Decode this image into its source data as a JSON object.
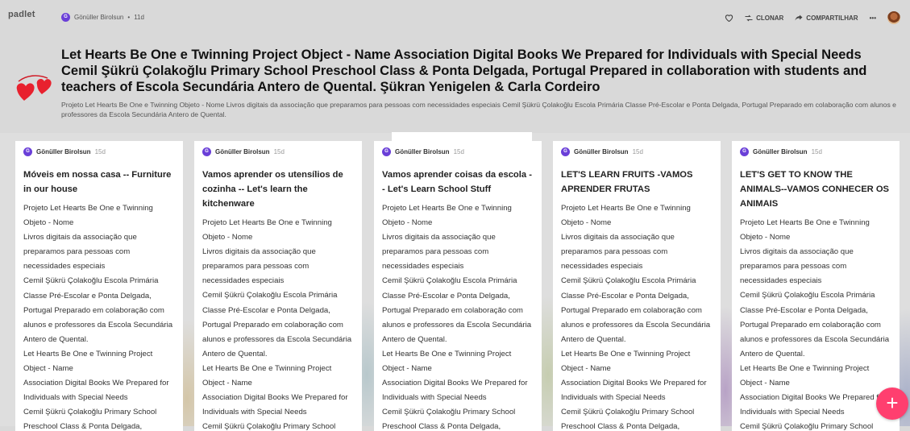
{
  "app": {
    "logo": "padlet"
  },
  "toolbar": {
    "clone_label": "CLONAR",
    "share_label": "COMPARTILHAR",
    "more_label": "•••"
  },
  "board": {
    "author": "Gönüller Birolsun",
    "author_initial": "G",
    "separator": "•",
    "age": "11d",
    "title": "Let Hearts Be One e Twinning Project Object - Name Association Digital Books We Prepared for Individuals with Special Needs Cemil Şükrü Çolakoğlu Primary School Preschool Class & Ponta Delgada, Portugal Prepared in collaboration with students and teachers of Escola Secundária Antero de Quental. Şükran Yenigelen & Carla Cordeiro",
    "description": "Projeto Let Hearts Be One e Twinning Objeto - Nome Livros digitais da associação que preparamos para pessoas com necessidades especiais Cemil Şükrü Çolakoğlu Escola Primária Classe Pré-Escolar e Ponta Delgada, Portugal Preparado em colaboração com alunos e professores da Escola Secundária Antero de Quental."
  },
  "cards": [
    {
      "author": "Gönüller Birolsun",
      "author_initial": "G",
      "age": "15d",
      "title": "Móveis em nossa casa -- Furniture in our house",
      "body": "Projeto Let Hearts Be One e Twinning Objeto - Nome\n Livros digitais da associação que preparamos para pessoas com necessidades especiais\nCemil Şükrü Çolakoğlu Escola Primária Classe Pré-Escolar e Ponta Delgada, Portugal Preparado em colaboração com alunos e professores da Escola Secundária Antero de Quental.\nLet Hearts Be One e Twinning Project Object - Name\n Association Digital Books We Prepared for Individuals with Special Needs\nCemil Şükrü Çolakoğlu Primary School Preschool Class & Ponta Delgada,"
    },
    {
      "author": "Gönüller Birolsun",
      "author_initial": "G",
      "age": "15d",
      "title": "Vamos aprender os utensílios de cozinha -- Let's learn the kitchenware",
      "body": "Projeto Let Hearts Be One e Twinning Objeto - Nome\n Livros digitais da associação que preparamos para pessoas com necessidades especiais\nCemil Şükrü Çolakoğlu Escola Primária Classe Pré-Escolar e Ponta Delgada, Portugal Preparado em colaboração com alunos e professores da Escola Secundária Antero de Quental.\nLet Hearts Be One e Twinning Project Object - Name\n Association Digital Books We Prepared for Individuals with Special Needs\nCemil Şükrü Çolakoğlu Primary School"
    },
    {
      "author": "Gönüller Birolsun",
      "author_initial": "G",
      "age": "15d",
      "title": "Vamos aprender coisas da escola -- Let's Learn School Stuff",
      "body": "Projeto Let Hearts Be One e Twinning Objeto - Nome\n Livros digitais da associação que preparamos para pessoas com necessidades especiais\nCemil Şükrü Çolakoğlu Escola Primária Classe Pré-Escolar e Ponta Delgada, Portugal Preparado em colaboração com alunos e professores da Escola Secundária Antero de Quental.\nLet Hearts Be One e Twinning Project Object - Name\n Association Digital Books We Prepared for Individuals with Special Needs\nCemil Şükrü Çolakoğlu Primary School Preschool Class & Ponta Delgada,"
    },
    {
      "author": "Gönüller Birolsun",
      "author_initial": "G",
      "age": "15d",
      "title": "LET'S LEARN FRUITS -VAMOS APRENDER FRUTAS",
      "body": "Projeto Let Hearts Be One e Twinning Objeto - Nome\n Livros digitais da associação que preparamos para pessoas com necessidades especiais\nCemil Şükrü Çolakoğlu Escola Primária Classe Pré-Escolar e Ponta Delgada, Portugal Preparado em colaboração com alunos e professores da Escola Secundária Antero de Quental.\nLet Hearts Be One e Twinning Project Object - Name\n Association Digital Books We Prepared for Individuals with Special Needs\nCemil Şükrü Çolakoğlu Primary School Preschool Class & Ponta Delgada,"
    },
    {
      "author": "Gönüller Birolsun",
      "author_initial": "G",
      "age": "15d",
      "title": "LET'S GET TO KNOW THE ANIMALS--VAMOS CONHECER OS ANIMAIS",
      "body": "Projeto Let Hearts Be One e Twinning Objeto - Nome\n Livros digitais da associação que preparamos para pessoas com necessidades especiais\nCemil Şükrü Çolakoğlu Escola Primária Classe Pré-Escolar e Ponta Delgada, Portugal Preparado em colaboração com alunos e professores da Escola Secundária Antero de Quental.\nLet Hearts Be One e Twinning Project Object - Name\n Association Digital Books We Prepared for Individuals with Special Needs\nCemil Şükrü Çolakoğlu Primary School"
    }
  ],
  "fab": {
    "label": "+"
  },
  "colors": {
    "accent": "#ff3f6f",
    "avatar": "#6a3fd8",
    "heart": "#e8212e"
  }
}
